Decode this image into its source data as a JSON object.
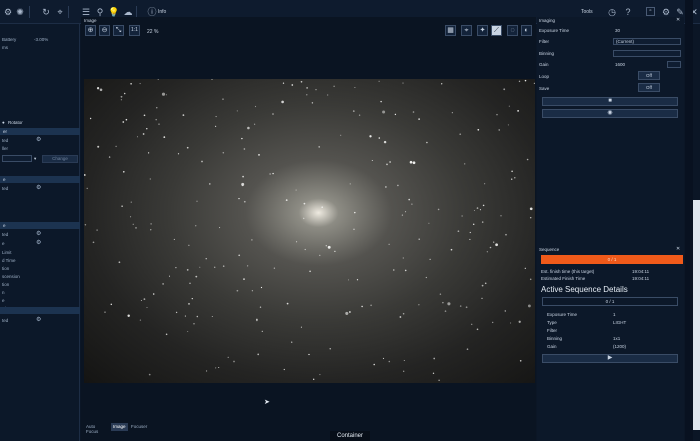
{
  "toolbar": {
    "info_label": "Info",
    "tools_label": "Tools",
    "icons": [
      "gear-icon",
      "atom-icon",
      "refresh-icon",
      "telescope-icon",
      "list-icon",
      "bulb-icon",
      "cloud-icon",
      "filter-icon"
    ]
  },
  "left_panel": {
    "rows_top": [
      "Battery",
      "-3.00%",
      "ms"
    ],
    "tab_rotator": "Rotator",
    "section1": {
      "title": "er",
      "rows": [
        "ted",
        "ller"
      ],
      "change_btn": "Change"
    },
    "section2": {
      "title": "e",
      "rows": [
        "ted"
      ]
    },
    "section3": {
      "title": "e",
      "rows": [
        "ted",
        "e",
        "Limit",
        "d Time",
        "tion",
        "scension",
        "tion",
        "n",
        "e",
        "Pier"
      ]
    },
    "section4": {
      "title": "",
      "rows": [
        "ted"
      ]
    }
  },
  "image_panel": {
    "title": "Image",
    "zoom_fit": "1:1",
    "zoom_pct": "22 %",
    "tabs": [
      "Auto Focus",
      "Image",
      "Focuser"
    ]
  },
  "imaging": {
    "title": "Imaging",
    "exposure_label": "Exposure Time",
    "exposure_value": "30",
    "filter_label": "Filter",
    "filter_value": "(Current)",
    "binning_label": "Binning",
    "gain_label": "Gain",
    "gain_value": "1600",
    "loop_label": "Loop",
    "loop_value": "Off",
    "save_label": "Save",
    "save_value": "Off"
  },
  "sequence": {
    "title": "Sequence",
    "progress_text": "0 / 1",
    "progress": 1.0,
    "est_finish_label": "Est. finish time (this target)",
    "est_finish_value": "19:04:11",
    "est_finish_time_label": "Estimated Finish Time",
    "est_finish_time_value": "19:04:11",
    "details_title": "Active Sequence Details",
    "count": "0 / 1",
    "rows": [
      {
        "label": "Exposure Time",
        "value": "1"
      },
      {
        "label": "Type",
        "value": "LIGHT"
      },
      {
        "label": "Filter",
        "value": ""
      },
      {
        "label": "Binning",
        "value": "1x1"
      },
      {
        "label": "Gain",
        "value": "(1200)"
      }
    ]
  },
  "footer": {
    "container_label": "Container"
  },
  "colors": {
    "accent": "#f05a1a",
    "panel": "#0c1829",
    "header": "#1c3350"
  }
}
